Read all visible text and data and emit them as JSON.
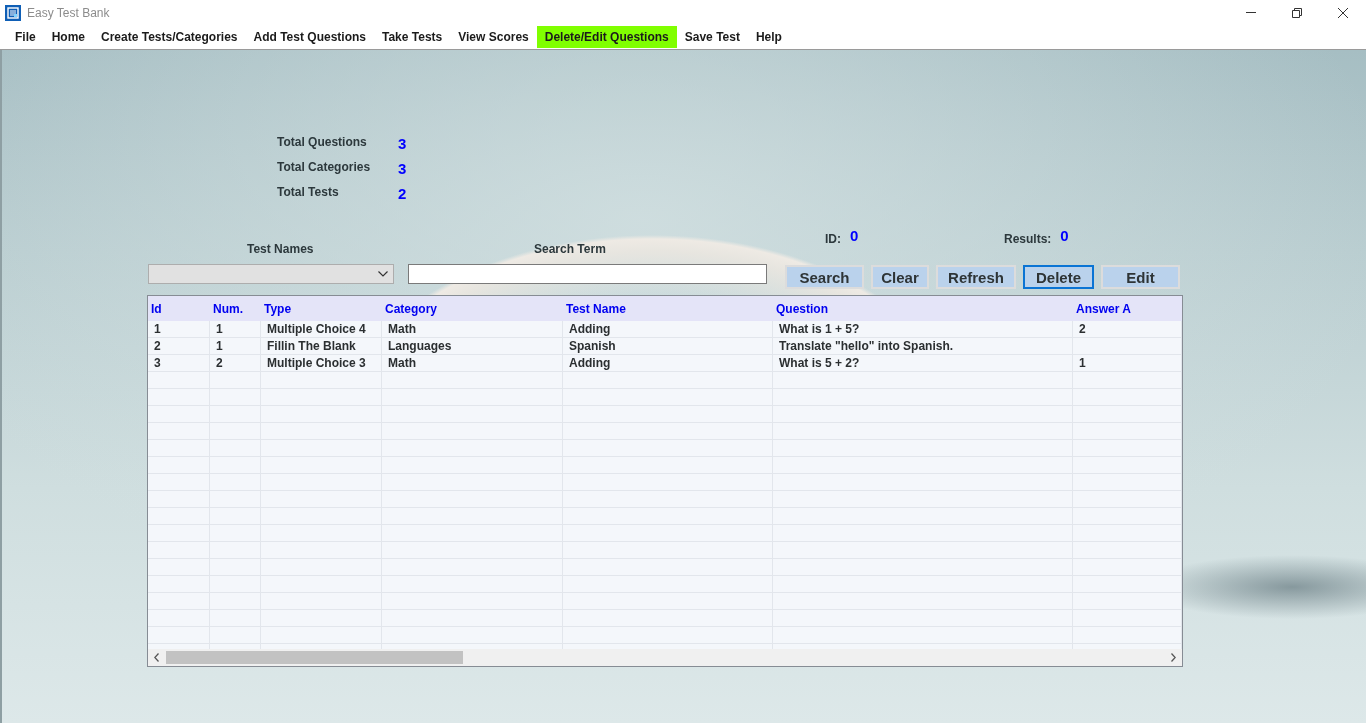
{
  "window": {
    "title": "Easy Test Bank"
  },
  "menu": [
    {
      "label": "File",
      "selected": false
    },
    {
      "label": "Home",
      "selected": false
    },
    {
      "label": "Create Tests/Categories",
      "selected": false
    },
    {
      "label": "Add Test Questions",
      "selected": false
    },
    {
      "label": "Take Tests",
      "selected": false
    },
    {
      "label": "View Scores",
      "selected": false
    },
    {
      "label": "Delete/Edit Questions",
      "selected": true
    },
    {
      "label": "Save Test",
      "selected": false
    },
    {
      "label": "Help",
      "selected": false
    }
  ],
  "stats": [
    {
      "label": "Total Questions",
      "value": "3"
    },
    {
      "label": "Total Categories",
      "value": "3"
    },
    {
      "label": "Total Tests",
      "value": "2"
    }
  ],
  "filters": {
    "test_names": {
      "label": "Test Names"
    },
    "search": {
      "label": "Search Term"
    }
  },
  "counters": [
    {
      "label": "ID:",
      "value": "0"
    },
    {
      "label": "Results:",
      "value": "0"
    }
  ],
  "buttons": [
    {
      "label": "Search",
      "focused": false
    },
    {
      "label": "Clear",
      "focused": false
    },
    {
      "label": "Refresh",
      "focused": false
    },
    {
      "label": "Delete",
      "focused": true
    },
    {
      "label": "Edit",
      "focused": false
    }
  ],
  "table": {
    "columns": [
      "Id",
      "Num.",
      "Type",
      "Category",
      "Test Name",
      "Question",
      "Answer A"
    ],
    "rows": [
      [
        "1",
        "1",
        "Multiple Choice 4",
        "Math",
        "Adding",
        "What is 1 + 5?",
        "2"
      ],
      [
        "2",
        "1",
        "Fillin The Blank",
        "Languages",
        "Spanish",
        "Translate \"hello\" into Spanish.",
        null
      ],
      [
        "3",
        "2",
        "Multiple Choice 3",
        "Math",
        "Adding",
        "What is 5 + 2?",
        "1"
      ]
    ]
  }
}
